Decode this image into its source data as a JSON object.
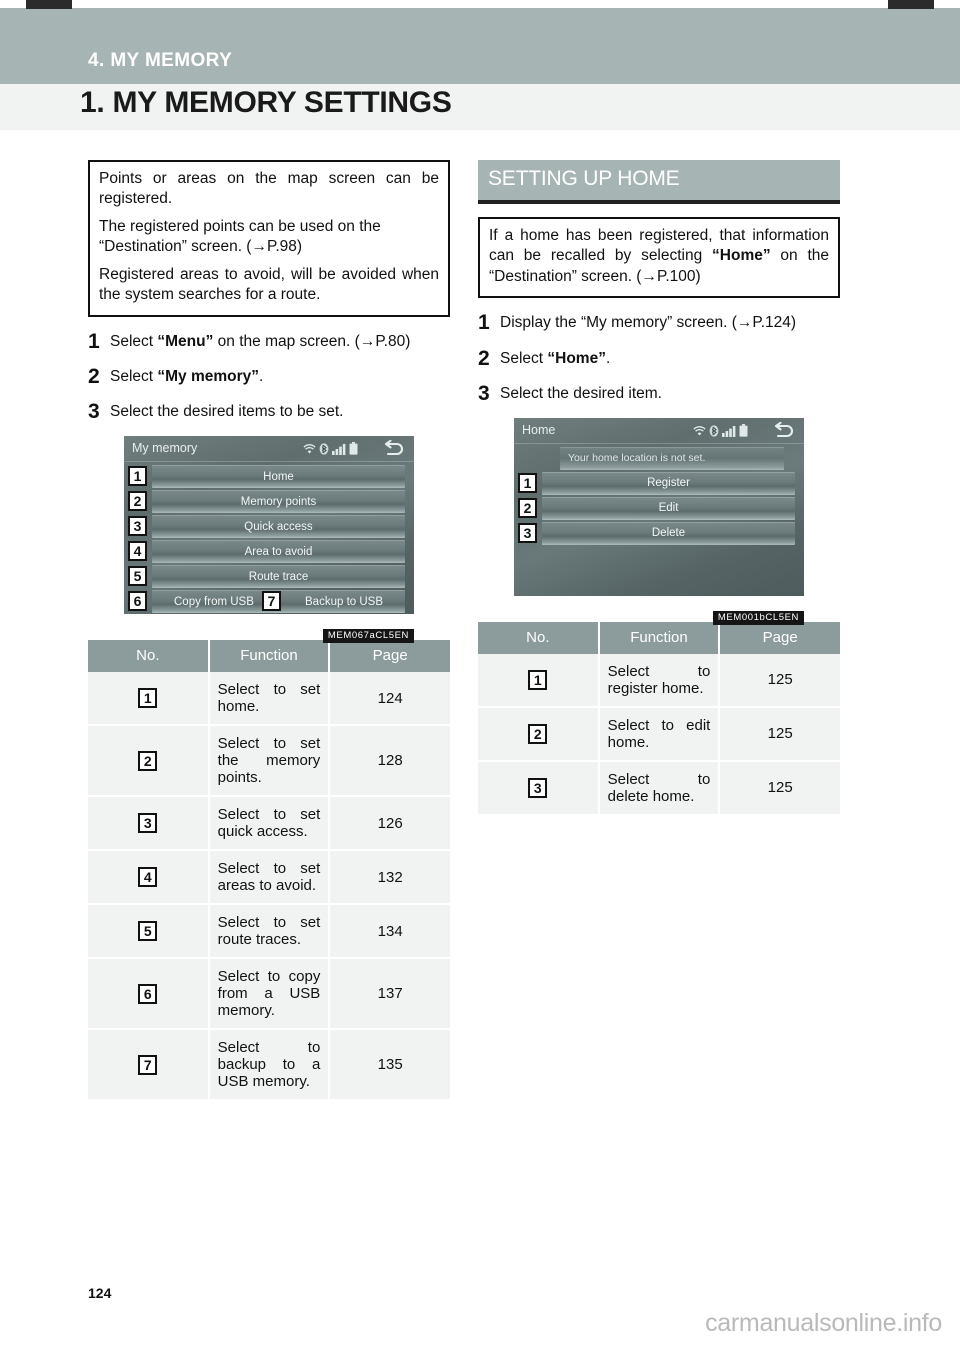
{
  "marks": {
    "top_left": "crop-mark",
    "top_right": "crop-mark"
  },
  "header": {
    "chapter": "4. MY MEMORY",
    "section": "1. MY MEMORY SETTINGS"
  },
  "left_column": {
    "intro_box": {
      "para1": "Points or areas on the map screen can be registered.",
      "para2": "The registered points can be used on the “Destination” screen. (→P.98)",
      "para3": "Registered areas to avoid, will be avoided when the system searches for a route."
    },
    "steps": [
      {
        "num": "1",
        "pre": "Select ",
        "bold": "“Menu”",
        "post": " on the map screen. (→P.80)"
      },
      {
        "num": "2",
        "pre": "Select ",
        "bold": "“My memory”",
        "post": "."
      },
      {
        "num": "3",
        "pre": "Select the desired items to be set.",
        "bold": "",
        "post": ""
      }
    ],
    "screenshot": {
      "title": "My memory",
      "caption": "MEM067aCL5EN",
      "rows": [
        {
          "badge": "1",
          "label": "Home"
        },
        {
          "badge": "2",
          "label": "Memory points"
        },
        {
          "badge": "3",
          "label": "Quick access"
        },
        {
          "badge": "4",
          "label": "Area to avoid"
        },
        {
          "badge": "5",
          "label": "Route trace"
        }
      ],
      "split_row": {
        "badge_left": "6",
        "label_left": "Copy from USB",
        "badge_right": "7",
        "label_right": "Backup to USB"
      }
    },
    "table": {
      "headers": {
        "no": "No.",
        "function": "Function",
        "page": "Page"
      },
      "rows": [
        {
          "no": "1",
          "function": "Select to set home.",
          "page": "124"
        },
        {
          "no": "2",
          "function": "Select to set the memory points.",
          "page": "128"
        },
        {
          "no": "3",
          "function": "Select to set quick access.",
          "page": "126"
        },
        {
          "no": "4",
          "function": "Select to set areas to avoid.",
          "page": "132"
        },
        {
          "no": "5",
          "function": "Select to set route traces.",
          "page": "134"
        },
        {
          "no": "6",
          "function": "Select to copy from a USB memory.",
          "page": "137"
        },
        {
          "no": "7",
          "function": "Select to backup to a USB memory.",
          "page": "135"
        }
      ]
    }
  },
  "right_column": {
    "sub_heading": "SETTING UP HOME",
    "intro_box": {
      "pre": "If a home has been registered, that information can be recalled by selecting ",
      "bold": "“Home”",
      "post": " on the “Destination” screen. (→P.100)"
    },
    "steps": [
      {
        "num": "1",
        "pre": "Display the “My memory” screen. (→P.124)",
        "bold": "",
        "post": ""
      },
      {
        "num": "2",
        "pre": "Select ",
        "bold": "“Home”",
        "post": "."
      },
      {
        "num": "3",
        "pre": "Select the desired item.",
        "bold": "",
        "post": ""
      }
    ],
    "screenshot": {
      "title": "Home",
      "caption": "MEM001bCL5EN",
      "note": "Your home location is not set.",
      "rows": [
        {
          "badge": "1",
          "label": "Register"
        },
        {
          "badge": "2",
          "label": "Edit"
        },
        {
          "badge": "3",
          "label": "Delete"
        }
      ]
    },
    "table": {
      "headers": {
        "no": "No.",
        "function": "Function",
        "page": "Page"
      },
      "rows": [
        {
          "no": "1",
          "function": "Select to register home.",
          "page": "125"
        },
        {
          "no": "2",
          "function": "Select to edit home.",
          "page": "125"
        },
        {
          "no": "3",
          "function": "Select to delete home.",
          "page": "125"
        }
      ]
    }
  },
  "footer": {
    "page_number": "124",
    "watermark": "carmanualsonline.info"
  },
  "icons": {
    "wifi": "wifi-icon",
    "bluetooth": "bluetooth-icon",
    "signal": "signal-bars-icon",
    "battery": "battery-icon",
    "back": "back-arrow-icon"
  },
  "colors": {
    "band": "#a7b4b4",
    "section_band": "#f1f2f2",
    "table_header": "#8c9c9c",
    "table_cell": "#f1f2f2"
  }
}
